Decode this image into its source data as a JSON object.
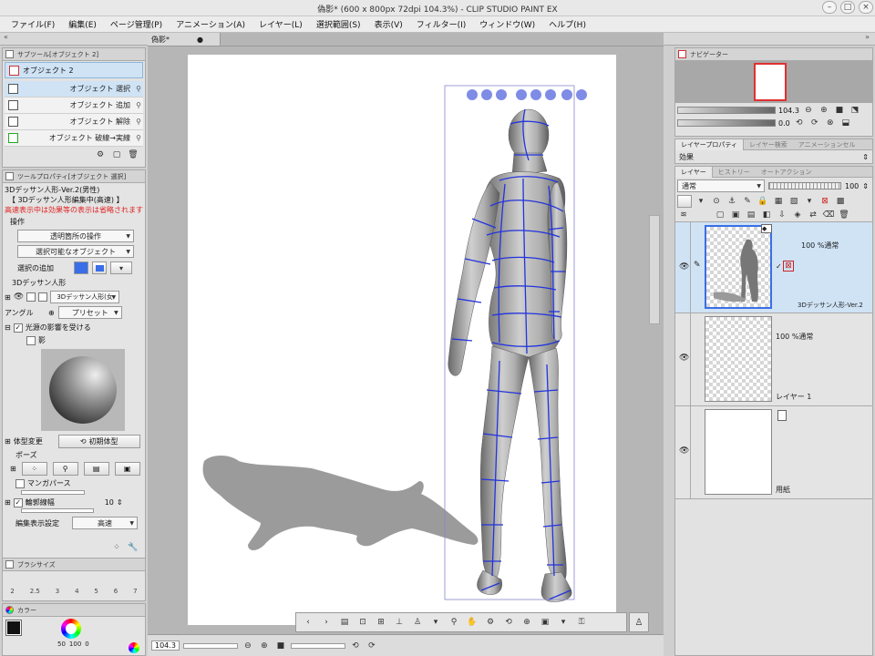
{
  "window": {
    "title": "偽影* (600 x 800px 72dpi 104.3%) - CLIP STUDIO PAINT EX"
  },
  "menu": [
    "ファイル(F)",
    "編集(E)",
    "ページ管理(P)",
    "アニメーション(A)",
    "レイヤー(L)",
    "選択範囲(S)",
    "表示(V)",
    "フィルター(I)",
    "ウィンドウ(W)",
    "ヘルプ(H)"
  ],
  "canvas_tab": {
    "label": "偽影*"
  },
  "subtool": {
    "tab": "サブツール[オブジェクト 2]",
    "group": "オブジェクト 2",
    "items": [
      "オブジェクト 選択",
      "オブジェクト 追加",
      "オブジェクト 解除",
      "オブジェクト 破線→実線"
    ]
  },
  "toolprop": {
    "tab": "ツールプロパティ[オブジェクト 選択]",
    "model_name": "3Dデッサン人形-Ver.2(男性)",
    "editing": "【 3Dデッサン人形編集中(高速) 】",
    "warning": "高速表示中は効果等の表示は省略されます",
    "section_operation": "操作",
    "transparent_op": "透明箇所の操作",
    "selectable_obj": "選択可能なオブジェクト",
    "selection_add": "選択の追加",
    "figure_section": "3Dデッサン人形",
    "figure_drop": "3Dデッサン人形(女",
    "angle_label": "アングル",
    "preset_label": "プリセット",
    "light_label": "光源の影響を受ける",
    "shadow_label": "影",
    "body_change": "体型変更",
    "initial_body": "初期体型",
    "pose_label": "ポーズ",
    "manga_perspective": "マンガパース",
    "outline_label": "輪郭線幅",
    "outline_value": "10",
    "edit_display_label": "編集表示設定",
    "edit_display_value": "高速"
  },
  "brush": {
    "tab": "ブラシサイズ",
    "sizes": [
      "2",
      "2.5",
      "3",
      "4",
      "5",
      "6",
      "7"
    ]
  },
  "color": {
    "tab": "カラー",
    "values": [
      "50",
      "100",
      "0"
    ]
  },
  "zoom": "104.3",
  "navigator": {
    "tab": "ナビゲーター",
    "zoom": "104.3",
    "angle": "0.0"
  },
  "layerprop": {
    "tab": "レイヤープロパティ",
    "tab2": "レイヤー検索",
    "tab3": "アニメーションセル",
    "effect": "効果"
  },
  "layers": {
    "tab": "レイヤー",
    "tab2": "ヒストリー",
    "tab3": "オートアクション",
    "blend": "通常",
    "opacity": "100",
    "items": [
      {
        "meta": "100 %通常",
        "name": "3Dデッサン人形-Ver.2"
      },
      {
        "meta": "100 %通常",
        "name": "レイヤー 1"
      },
      {
        "meta": "",
        "name": "用紙"
      }
    ]
  },
  "colors": {
    "accent": "#3a6ee8",
    "selection": "#cfe3f5",
    "wire": "#2233dd"
  }
}
